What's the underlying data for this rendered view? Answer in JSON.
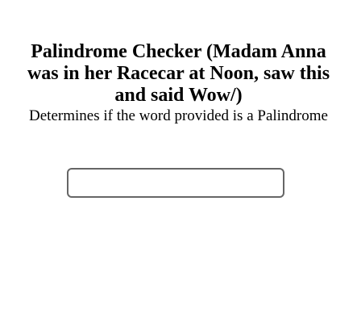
{
  "header": {
    "title": "Palindrome Checker (Madam Anna was in her Racecar at Noon, saw this and said Wow/)",
    "subtitle": "Determines if the word provided is a Palindrome"
  },
  "word_input": {
    "value": "",
    "placeholder": ""
  }
}
